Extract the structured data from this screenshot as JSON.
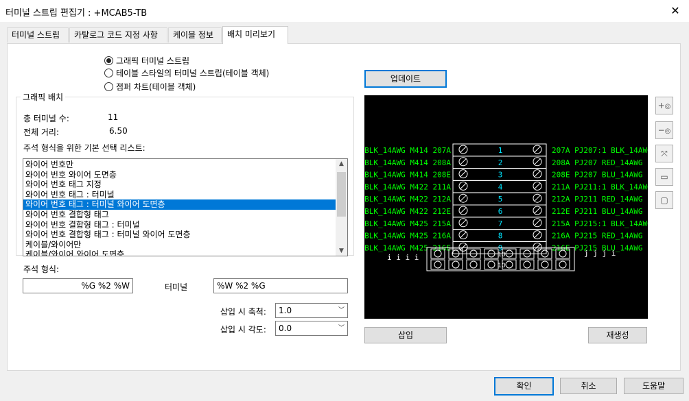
{
  "window": {
    "title": "터미널 스트립 편집기 : +MCAB5-TB",
    "close_glyph": "✕"
  },
  "tabs": [
    "터미널 스트립",
    "카탈로그 코드 지정 사항",
    "케이블 정보",
    "배치 미리보기"
  ],
  "radios": [
    {
      "label": "그래픽 터미널 스트립",
      "checked": true
    },
    {
      "label": "테이블 스타일의 터미널 스트립(테이블 객체)",
      "checked": false
    },
    {
      "label": "점퍼 차트(테이블 객체)",
      "checked": false
    }
  ],
  "graphic_layout": {
    "legend": "그래픽 배치",
    "total_terminals_label": "총 터미널 수:",
    "total_terminals_value": "11",
    "total_distance_label": "전체 거리:",
    "total_distance_value": "6.50",
    "list_label": "주석 형식을 위한 기본 선택 리스트:",
    "list_items": [
      "와이어 번호만",
      "와이어 번호 와이어 도면층",
      "와이어 번호 태그 지정",
      "와이어 번호 태그 : 터미널",
      "와이어 번호 태그 : 터미널 와이어 도면층",
      "와이어 번호 결합형 태그",
      "와이어 번호 결합형 태그 : 터미널",
      "와이어 번호 결합형 태그 : 터미널 와이어 도면층",
      "케이블/와이어만",
      "케이블/와이어 와이어 도면층"
    ],
    "selected_index": 4,
    "annotation_label": "주석 형식:",
    "annotation_left": "%G %2 %W",
    "annotation_mid": "터미널",
    "annotation_right": "%W %2 %G",
    "scale_label": "삽입 시 축척:",
    "scale_value": "1.0",
    "angle_label": "삽입 시 각도:",
    "angle_value": "0.0"
  },
  "preview": {
    "update_button": "업데이트",
    "insert_button": "삽입",
    "regen_button": "재생성",
    "rows": [
      {
        "left": "BLK_14AWG M414 207A",
        "num": "1",
        "right": "207A PJ207:1 BLK_14AWG"
      },
      {
        "left": "BLK_14AWG M414 208A",
        "num": "2",
        "right": "208A PJ207 RED_14AWG"
      },
      {
        "left": "BLK_14AWG M414 208E",
        "num": "3",
        "right": "208E PJ207 BLU_14AWG"
      },
      {
        "left": "BLK_14AWG M422 211A",
        "num": "4",
        "right": "211A PJ211:1 BLK_14AWG"
      },
      {
        "left": "BLK_14AWG M422 212A",
        "num": "5",
        "right": "212A PJ211 RED_14AWG"
      },
      {
        "left": "BLK_14AWG M422 212E",
        "num": "6",
        "right": "212E PJ211 BLU_14AWG"
      },
      {
        "left": "BLK_14AWG M425 215A",
        "num": "7",
        "right": "215A PJ215:1 BLK_14AWG"
      },
      {
        "left": "BLK_14AWG M425 216A",
        "num": "8",
        "right": "216A PJ215 RED_14AWG"
      },
      {
        "left": "BLK_14AWG M425 216E",
        "num": "9",
        "right": "216E PJ215 BLU_14AWG"
      }
    ],
    "jumper_left": "i  i  i  i",
    "jumper_right": "j  j  j  i",
    "jumper_num_1": "10",
    "jumper_num_2": "10",
    "icons": [
      "zoom-in-icon",
      "zoom-out-icon",
      "zoom-extents-icon",
      "zoom-window-icon",
      "zoom-previous-icon"
    ]
  },
  "footer": {
    "ok": "확인",
    "cancel": "취소",
    "help": "도움말"
  },
  "colors": {
    "accent": "#0078d7",
    "preview_bg": "#000000",
    "wire_text": "#00ff00",
    "terminal_num": "#00e5ff"
  }
}
